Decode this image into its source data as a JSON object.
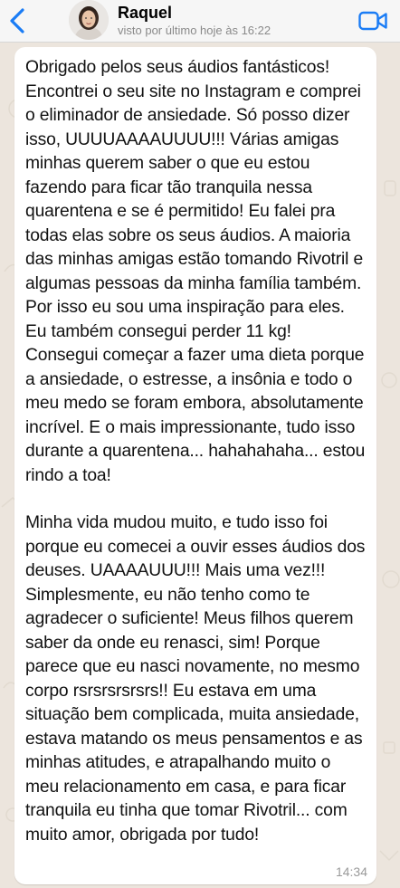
{
  "header": {
    "contact_name": "Raquel",
    "last_seen": "visto por último hoje às 16:22",
    "back_icon": "chevron-left-icon",
    "call_icon": "video-camera-icon",
    "accent_color": "#1a7cf5"
  },
  "message": {
    "paragraphs": [
      "Obrigado pelos seus áudios fantásticos! Encontrei o seu site no Instagram e comprei o eliminador de ansiedade. Só posso dizer isso, UUUUAAAAUUUU!!! Várias amigas minhas querem saber o que eu estou fazendo para ficar tão tranquila nessa quarentena e se é permitido! Eu falei pra todas elas sobre os seus áudios. A maioria das minhas amigas estão tomando Rivotril e algumas pessoas da minha família também. Por isso eu sou uma inspiração para eles. Eu também consegui perder 11 kg! Consegui começar a fazer uma dieta porque a ansiedade, o estresse, a insônia e todo o meu medo se foram embora, absolutamente incrível. E o mais impressionante, tudo isso durante a quarentena... hahahahaha... estou rindo a toa!",
      "Minha vida mudou muito, e tudo isso foi porque eu comecei a ouvir esses áudios dos deuses. UAAAAUUU!!! Mais uma vez!!! Simplesmente, eu não tenho como te agradecer o suficiente! Meus filhos querem saber da onde eu renasci, sim! Porque parece que eu nasci novamente, no mesmo corpo rsrsrsrsrsrs!! Eu estava em uma situação bem complicada, muita ansiedade, estava matando os meus pensamentos e as minhas atitudes, e atrapalhando muito o meu relacionamento em casa, e para ficar tranquila eu tinha que tomar Rivotril... com muito amor, obrigada por tudo!"
    ],
    "time": "14:34"
  }
}
